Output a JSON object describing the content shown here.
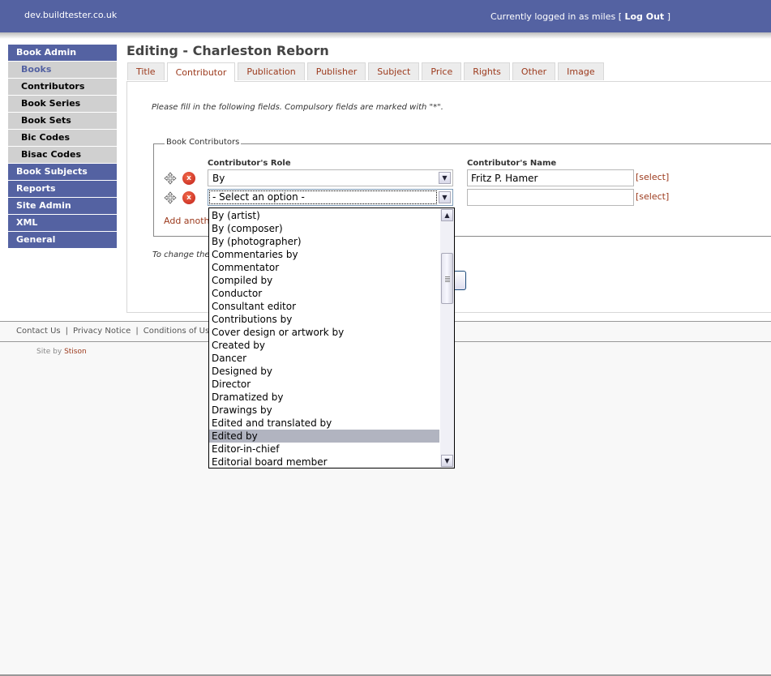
{
  "header": {
    "site_name": "dev.buildtester.co.uk",
    "login_prefix": "Currently logged in as miles [",
    "logout_label": "Log Out",
    "login_suffix": "]"
  },
  "sidebar": {
    "items": [
      {
        "label": "Book Admin",
        "type": "primary"
      },
      {
        "label": "Books",
        "type": "sub",
        "active": true
      },
      {
        "label": "Contributors",
        "type": "sub"
      },
      {
        "label": "Book Series",
        "type": "sub"
      },
      {
        "label": "Book Sets",
        "type": "sub"
      },
      {
        "label": "Bic Codes",
        "type": "sub"
      },
      {
        "label": "Bisac Codes",
        "type": "sub"
      },
      {
        "label": "Book Subjects",
        "type": "primary"
      },
      {
        "label": "Reports",
        "type": "primary"
      },
      {
        "label": "Site Admin",
        "type": "primary"
      },
      {
        "label": "XML",
        "type": "primary"
      },
      {
        "label": "General",
        "type": "primary"
      }
    ]
  },
  "main": {
    "title": "Editing - Charleston Reborn",
    "tabs": [
      {
        "label": "Title"
      },
      {
        "label": "Contributor",
        "active": true
      },
      {
        "label": "Publication"
      },
      {
        "label": "Publisher"
      },
      {
        "label": "Subject"
      },
      {
        "label": "Price"
      },
      {
        "label": "Rights"
      },
      {
        "label": "Other"
      },
      {
        "label": "Image"
      }
    ],
    "intro": "Please fill in the following fields. Compulsory fields are marked with \"*\".",
    "fieldset_legend": "Book Contributors",
    "role_header": "Contributor's Role",
    "name_header": "Contributor's Name",
    "rows": [
      {
        "role": "By",
        "name": "Fritz P. Hamer",
        "select_link": "[select]"
      },
      {
        "role": "- Select an option -",
        "name": "",
        "select_link": "[select]"
      }
    ],
    "add_another": "Add another",
    "change_note": "To change the"
  },
  "dropdown": {
    "highlighted": "Edited by",
    "options": [
      "By (artist)",
      "By (composer)",
      "By (photographer)",
      "Commentaries by",
      "Commentator",
      "Compiled by",
      "Conductor",
      "Consultant editor",
      "Contributions by",
      "Cover design or artwork by",
      "Created by",
      "Dancer",
      "Designed by",
      "Director",
      "Dramatized by",
      "Drawings by",
      "Edited and translated by",
      "Edited by",
      "Editor-in-chief",
      "Editorial board member"
    ]
  },
  "footer": {
    "links": [
      "Contact Us",
      "Privacy Notice",
      "Conditions of Use"
    ],
    "site_by_prefix": "Site by",
    "site_by_name": "Stison"
  },
  "colors": {
    "brand": "#5462a2",
    "link": "#9c3a1d",
    "sub_nav_bg": "#d0d0d0",
    "highlight": "#b1b4c0"
  }
}
